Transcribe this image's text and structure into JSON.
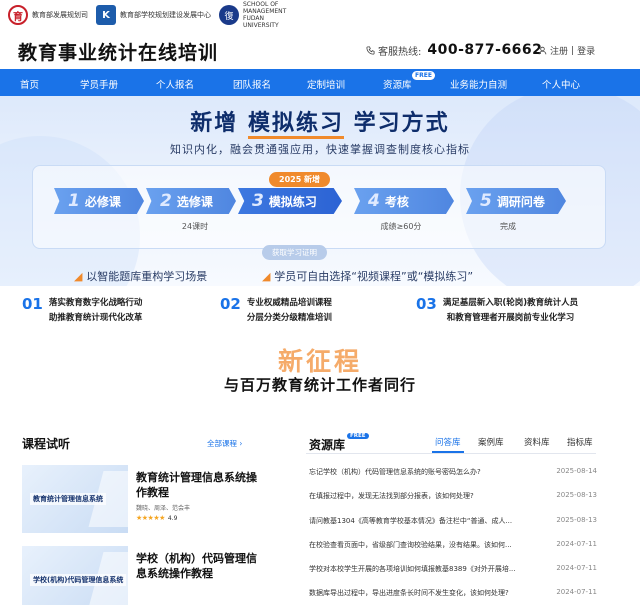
{
  "logos": [
    {
      "mark": "育",
      "text": "教育部发展规划司"
    },
    {
      "mark": "K",
      "text": "教育部学校规划建设发展中心"
    },
    {
      "mark": "復",
      "text": "SCHOOL OF MANAGEMENT FUDAN UNIVERSITY"
    }
  ],
  "header": {
    "title": "教育事业统计在线培训",
    "hotline_label": "客服热线:",
    "hotline_number": "400-877-6662",
    "register": "注册",
    "separator": "|",
    "login": "登录"
  },
  "nav": {
    "items": [
      "首页",
      "学员手册",
      "个人报名",
      "团队报名",
      "定制培训",
      "资源库",
      "业务能力自测",
      "个人中心"
    ],
    "free_badge": "FREE"
  },
  "banner": {
    "title_pre": "新增",
    "title_hl": "模拟练习",
    "title_post": "学习方式",
    "subtitle": "知识内化，融会贯通强应用，快速掌握调查制度核心指标",
    "new_tag": "2025 新增",
    "steps": [
      {
        "num": "1",
        "label": "必修课",
        "note": ""
      },
      {
        "num": "2",
        "label": "选修课",
        "note": "24课时"
      },
      {
        "num": "3",
        "label": "模拟练习",
        "note": ""
      },
      {
        "num": "4",
        "label": "考核",
        "note": "成绩≥60分"
      },
      {
        "num": "5",
        "label": "调研问卷",
        "note": "完成"
      }
    ],
    "cert": "获取学习证明",
    "line_left": "以智能题库重构学习场景",
    "line_right": "学员可自由选择“视频课程”或“模拟练习”"
  },
  "features": [
    {
      "num": "01",
      "line1": "落实教育数字化战略行动",
      "line2": "助推教育统计现代化改革"
    },
    {
      "num": "02",
      "line1": "专业权威精品培训课程",
      "line2": "分层分类分级精准培训"
    },
    {
      "num": "03",
      "line1": "满足基层新入职(轮岗)教育统计人员",
      "line2": "和教育管理者开展岗前专业化学习"
    }
  ],
  "slogan": {
    "big": "新征程",
    "main": "与百万教育统计工作者同行"
  },
  "courses": {
    "title": "课程试听",
    "all_link": "全部课程 ›",
    "items": [
      {
        "thumb_text": "教育统计管理信息系统",
        "title": "教育统计管理信息系统操作教程",
        "authors": "魏晓、周泽、范会丰",
        "rating": 4.9,
        "rating_text": "4.9",
        "stars": "★★★★★"
      },
      {
        "thumb_text": "学校(机构)代码管理信息系统",
        "title": "学校（机构）代码管理信息系统操作教程",
        "authors": "",
        "rating": null,
        "rating_text": "",
        "stars": ""
      }
    ]
  },
  "resources": {
    "title": "资源库",
    "free_badge": "FREE",
    "tabs": [
      "问答库",
      "案例库",
      "资料库",
      "指标库"
    ],
    "active_tab": 0,
    "items": [
      {
        "q": "忘记学校（机构）代码管理信息系统的账号密码怎么办?",
        "date": "2025-08-14"
      },
      {
        "q": "在填报过程中，发现无法找到部分报表，该如何处理?",
        "date": "2025-08-13"
      },
      {
        "q": "请问教基1304《高等教育学校基本情况》备注栏中“普通、成人...",
        "date": "2025-08-13"
      },
      {
        "q": "在校验查看页面中，省级部门查询校验结果，没有结果。该如何...",
        "date": "2024-07-11"
      },
      {
        "q": "学校对本校学生开展的各项培训如何填报教基8389《对外开展培...",
        "date": "2024-07-11"
      },
      {
        "q": "数据库导出过程中，导出进度条长时间不发生变化，该如何处理?",
        "date": "2024-07-11"
      }
    ]
  },
  "colors": {
    "accent": "#1a73e8",
    "orange": "#f08a2c",
    "dark_blue": "#0e2d6b"
  }
}
